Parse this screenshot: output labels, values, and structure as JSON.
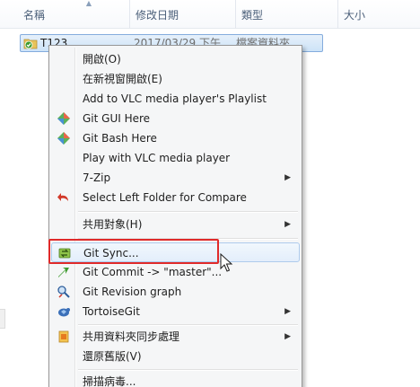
{
  "columns": {
    "name": "名稱",
    "date": "修改日期",
    "type": "類型",
    "size": "大小"
  },
  "file": {
    "name": "T123",
    "date": "2017/03/29 下午",
    "type": "檔案資料夾",
    "icon": "folder-git-icon"
  },
  "menu": {
    "items": [
      {
        "label": "開啟(O)",
        "icon": null
      },
      {
        "label": "在新視窗開啟(E)",
        "icon": null
      },
      {
        "label": "Add to VLC media player's Playlist",
        "icon": null
      },
      {
        "label": "Git GUI Here",
        "icon": "git-diamond-icon"
      },
      {
        "label": "Git Bash Here",
        "icon": "git-diamond-icon"
      },
      {
        "label": "Play with VLC media player",
        "icon": null
      },
      {
        "label": "7-Zip",
        "icon": null,
        "submenu": true
      },
      {
        "label": "Select Left Folder for Compare",
        "icon": "undo-arrow-icon"
      },
      {
        "label": "共用對象(H)",
        "icon": null,
        "submenu": true
      },
      {
        "label": "Git Sync...",
        "icon": "git-sync-icon",
        "hover": true
      },
      {
        "label": "Git Commit -> \"master\"...",
        "icon": "git-commit-icon"
      },
      {
        "label": "Git Revision graph",
        "icon": "revision-graph-icon"
      },
      {
        "label": "TortoiseGit",
        "icon": "tortoisegit-icon",
        "submenu": true
      },
      {
        "label": "共用資料夾同步處理",
        "icon": "sync-folder-icon",
        "submenu": true
      },
      {
        "label": "還原舊版(V)",
        "icon": null
      },
      {
        "label": "掃描病毒...",
        "icon": null
      }
    ]
  },
  "colors": {
    "highlight_border": "#e02a2a",
    "selection": "#cde3f8",
    "menu_background": "#f5f6f7"
  }
}
